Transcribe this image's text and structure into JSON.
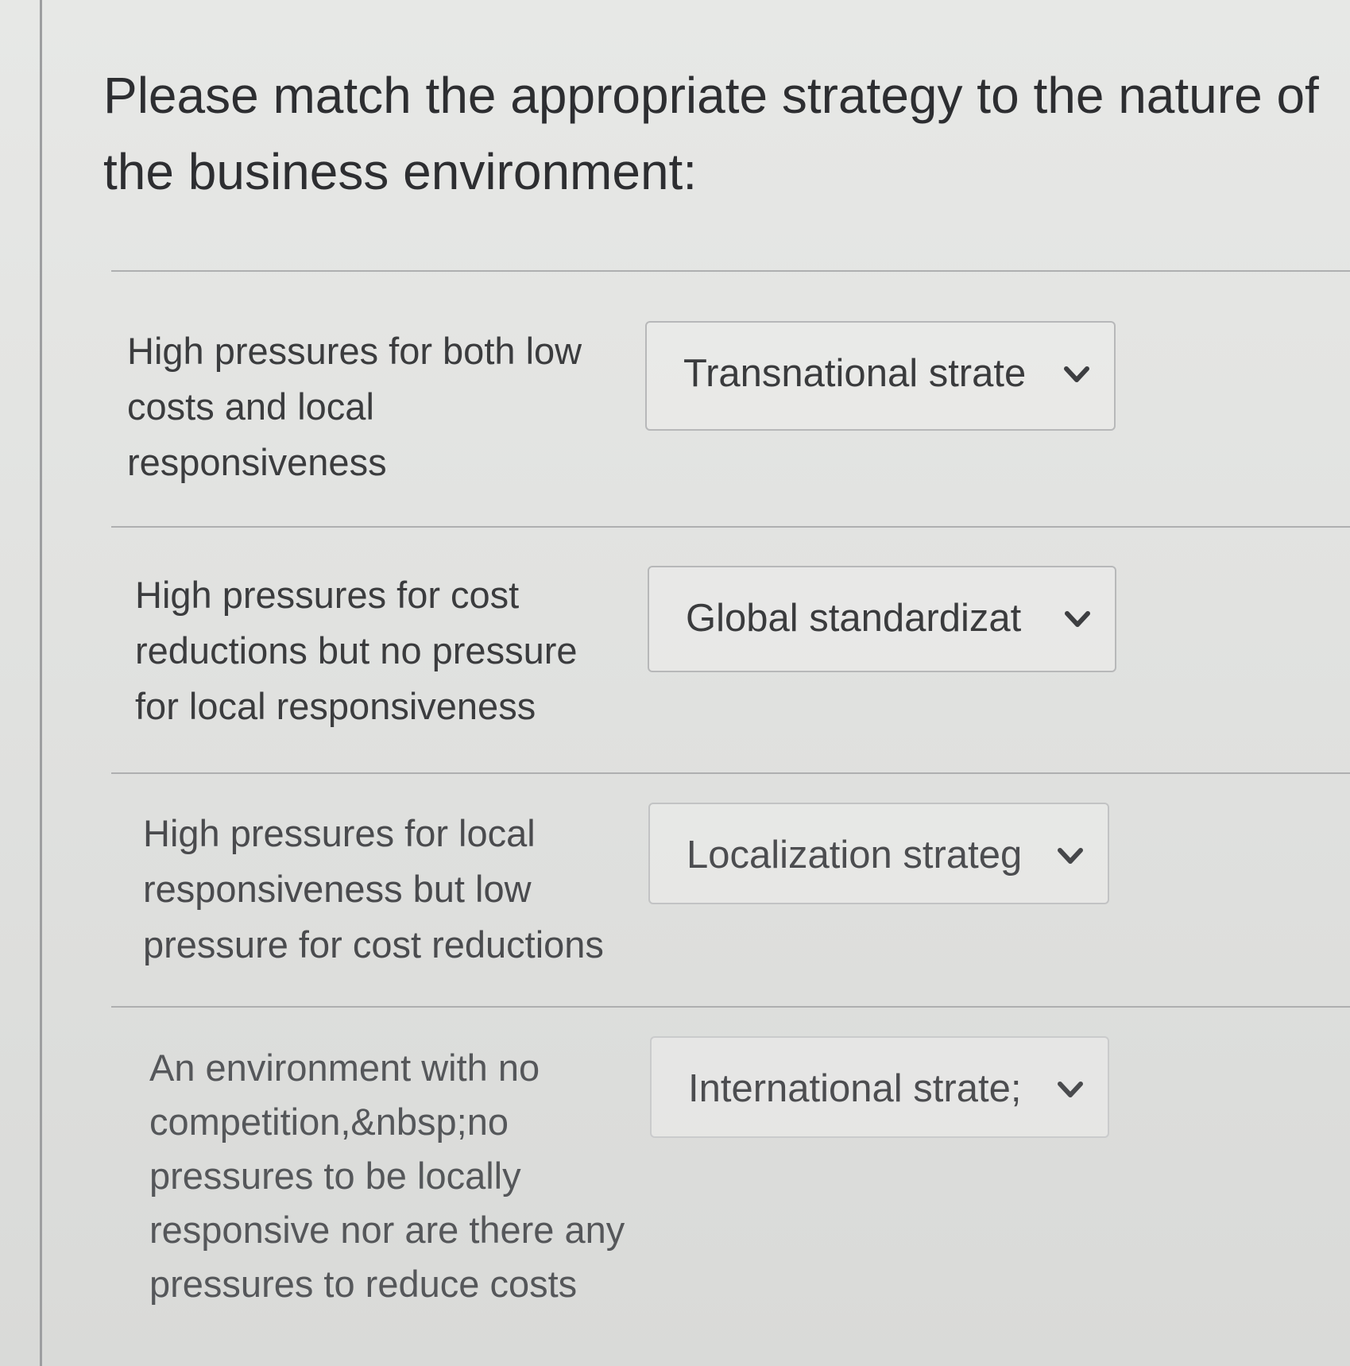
{
  "question": {
    "text": "Please match the appropriate strategy to the nature of the business environment:"
  },
  "rows": [
    {
      "prompt": "High pressures for both low costs and local responsiveness",
      "selected": "Transnational strate"
    },
    {
      "prompt": "High pressures for cost reductions but no pressure for local responsiveness",
      "selected": "Global standardizat"
    },
    {
      "prompt": "High pressures for local responsiveness but low pressure for cost reductions",
      "selected": "Localization strateg"
    },
    {
      "prompt": "An environment with no competition,&nbsp;no pressures to be locally responsive nor are there any pressures to reduce costs",
      "selected": "International strate;"
    }
  ],
  "icons": {
    "dropdown": "chevron-down-icon"
  }
}
